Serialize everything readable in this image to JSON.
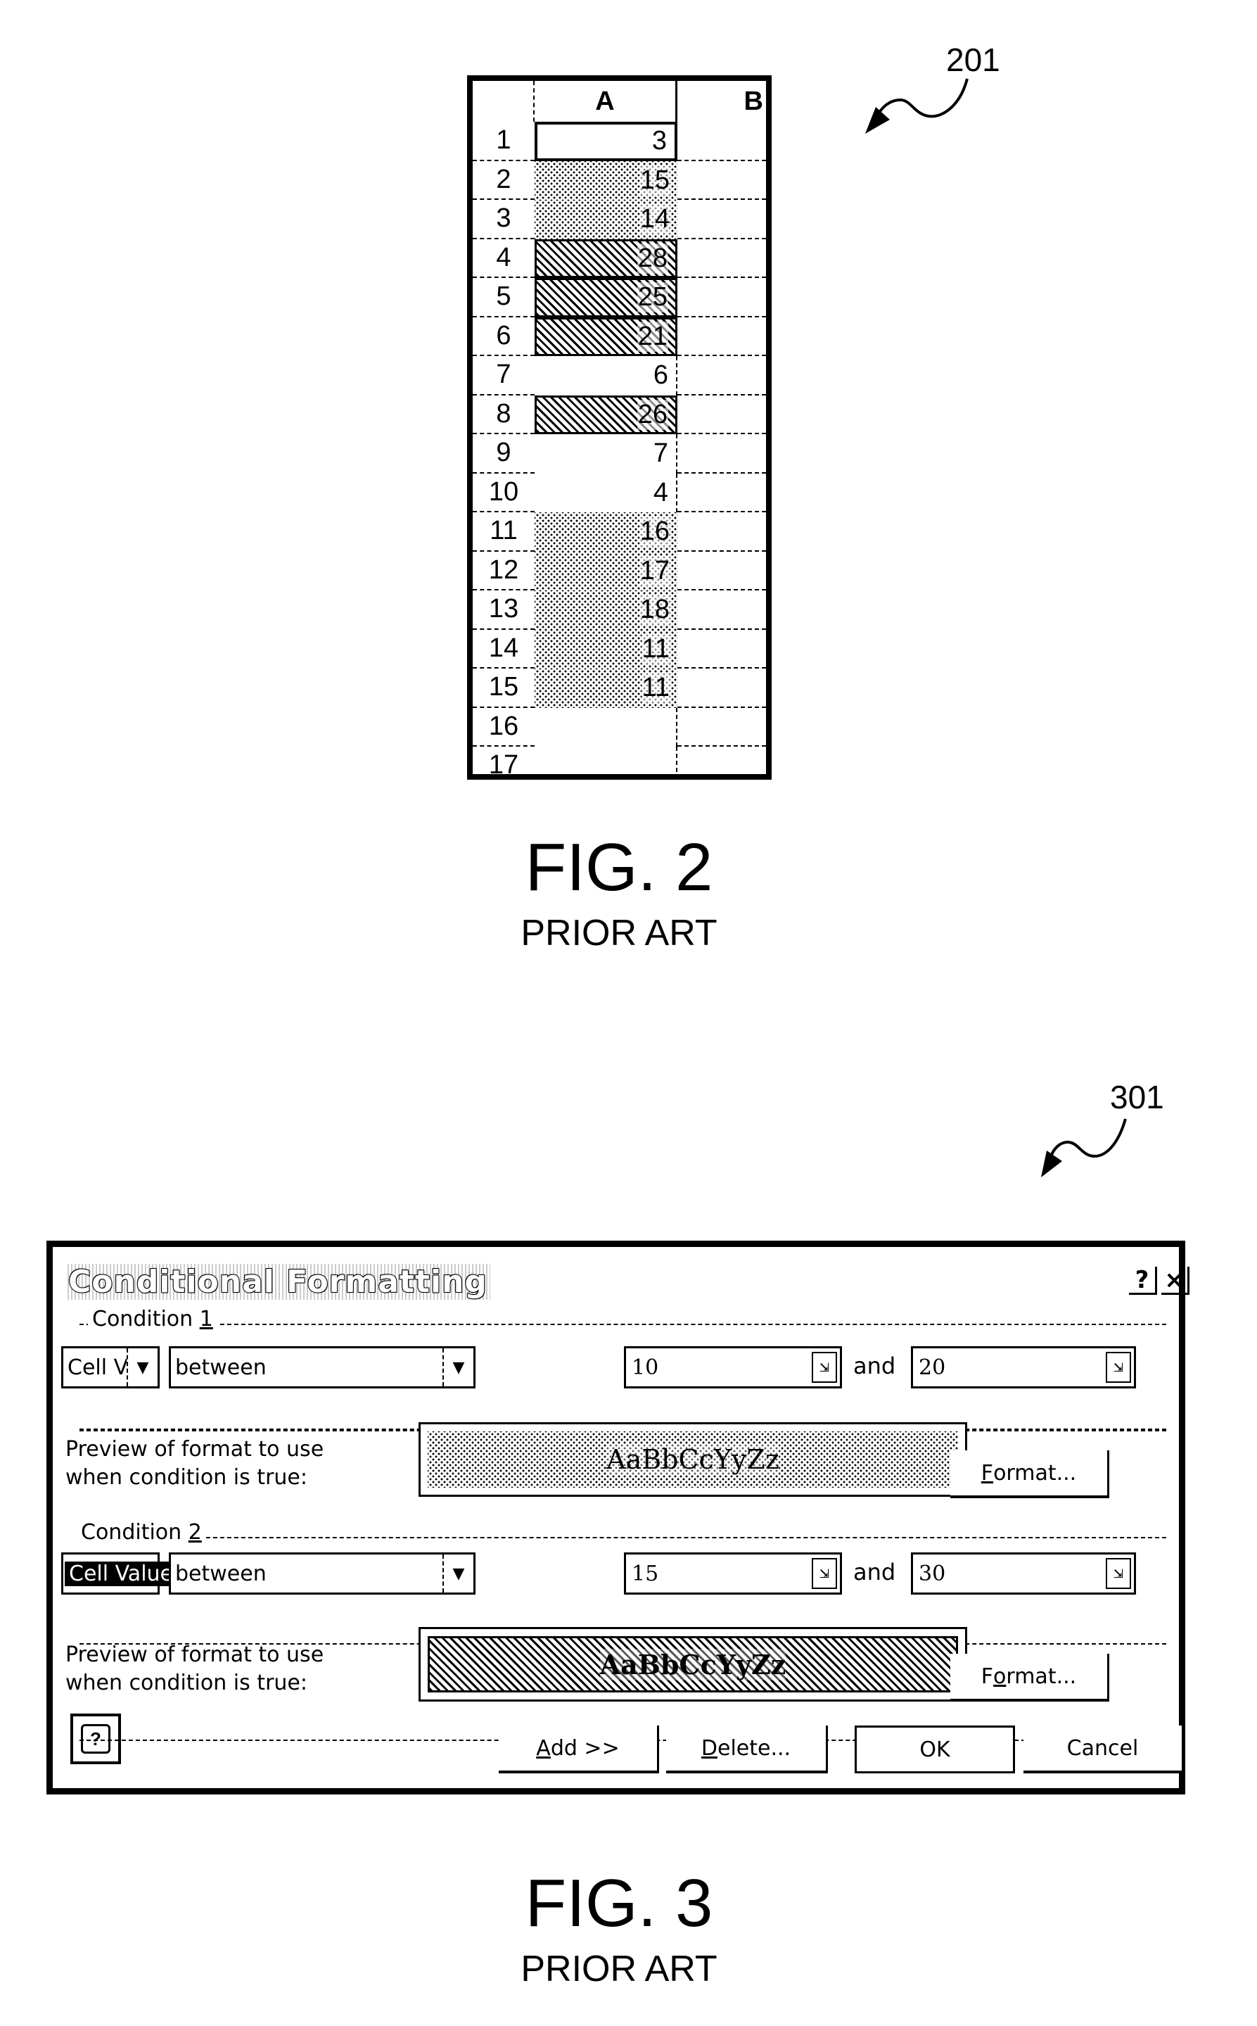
{
  "fig2": {
    "ref_number": "201",
    "caption": "FIG. 2",
    "subcaption": "PRIOR ART",
    "spreadsheet": {
      "columns": [
        "A",
        "B"
      ],
      "rows": [
        {
          "row": "1",
          "value": "3",
          "format": "none",
          "active": true
        },
        {
          "row": "2",
          "value": "15",
          "format": "dotted"
        },
        {
          "row": "3",
          "value": "14",
          "format": "dotted"
        },
        {
          "row": "4",
          "value": "28",
          "format": "hatched"
        },
        {
          "row": "5",
          "value": "25",
          "format": "hatched"
        },
        {
          "row": "6",
          "value": "21",
          "format": "hatched"
        },
        {
          "row": "7",
          "value": "6",
          "format": "none"
        },
        {
          "row": "8",
          "value": "26",
          "format": "hatched"
        },
        {
          "row": "9",
          "value": "7",
          "format": "none"
        },
        {
          "row": "10",
          "value": "4",
          "format": "none"
        },
        {
          "row": "11",
          "value": "16",
          "format": "dotted"
        },
        {
          "row": "12",
          "value": "17",
          "format": "dotted"
        },
        {
          "row": "13",
          "value": "18",
          "format": "dotted"
        },
        {
          "row": "14",
          "value": "11",
          "format": "dotted"
        },
        {
          "row": "15",
          "value": "11",
          "format": "dotted"
        },
        {
          "row": "16",
          "value": "",
          "format": "none"
        },
        {
          "row": "17",
          "value": "",
          "format": "none"
        }
      ]
    }
  },
  "fig3": {
    "ref_number": "301",
    "caption": "FIG. 3",
    "subcaption": "PRIOR ART",
    "dialog": {
      "title": "Conditional Formatting",
      "title_buttons": {
        "help": "?",
        "close": "×"
      },
      "conditions": [
        {
          "label": "Condition ",
          "label_accel": "1",
          "type_value": "Cell Value Is",
          "type_selected": false,
          "operator_value": "between",
          "value1": "10",
          "and_label": "and",
          "value2": "20",
          "preview_label_line1": "Preview of format to use",
          "preview_label_line2": "when condition is true:",
          "preview_text": "AaBbCcYyZz",
          "preview_pattern": "dotted",
          "format_button_pre": "",
          "format_button_accel": "F",
          "format_button_post": "ormat..."
        },
        {
          "label": "Condition ",
          "label_accel": "2",
          "type_value": "Cell Value Is",
          "type_selected": true,
          "operator_value": "between",
          "value1": "15",
          "and_label": "and",
          "value2": "30",
          "preview_label_line1": "Preview of format to use",
          "preview_label_line2": "when condition is true:",
          "preview_text": "AaBbCcYyZz",
          "preview_pattern": "hatched",
          "format_button_pre": "F",
          "format_button_accel": "o",
          "format_button_post": "rmat..."
        }
      ],
      "buttons": {
        "help_icon": "?",
        "add_accel": "A",
        "add_rest": "dd >>",
        "delete_accel": "D",
        "delete_rest": "elete...",
        "ok": "OK",
        "cancel": "Cancel"
      },
      "icons": {
        "dropdown": "▼",
        "collapse_dialog": "⇲"
      }
    }
  }
}
